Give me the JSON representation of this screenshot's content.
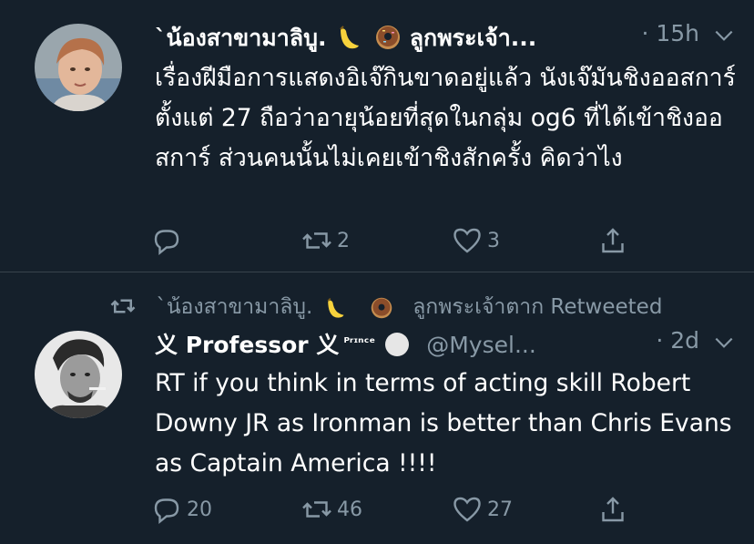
{
  "tweets": [
    {
      "display_name": "`น้องสาขามาลิบู.",
      "name_suffix": "ลูกพระเจ้า...",
      "dot": "·",
      "time": "15h",
      "text": "เรื่องฝีมือการแสดงอิเจ๊กินขาดอยู่แล้ว นังเจ๊มันชิงออสการ์ตั้งแต่ 27 ถือว่าอายุน้อยที่สุดในกลุ่ม og6 ที่ได้เข้าชิงออสการ์ ส่วนคนนั้นไม่เคยเข้าชิงสักครั้ง คิดว่าไง",
      "replies": "",
      "retweets": "2",
      "likes": "3"
    },
    {
      "retweet_context": "`น้องสาขามาลิบู.",
      "retweet_context_suffix": "ลูกพระเจ้าตาก Retweeted",
      "display_name": "义 Professor 义",
      "name_superscript": "ᴾʳᶦⁿᶜᵉ",
      "handle": "@Mysel...",
      "dot": "·",
      "time": "2d",
      "text": "RT if you think in terms of acting skill Robert Downy JR as Ironman is better than Chris Evans as Captain America !!!!",
      "replies": "20",
      "retweets": "46",
      "likes": "27"
    }
  ],
  "icons": [
    "reply-icon",
    "retweet-icon",
    "like-icon",
    "share-icon",
    "caret-down-icon",
    "banana-emoji",
    "donut-emoji",
    "circle-emoji"
  ],
  "colors": {
    "background": "#15202b",
    "secondary_text": "#8899a6",
    "divider": "#38444d"
  }
}
